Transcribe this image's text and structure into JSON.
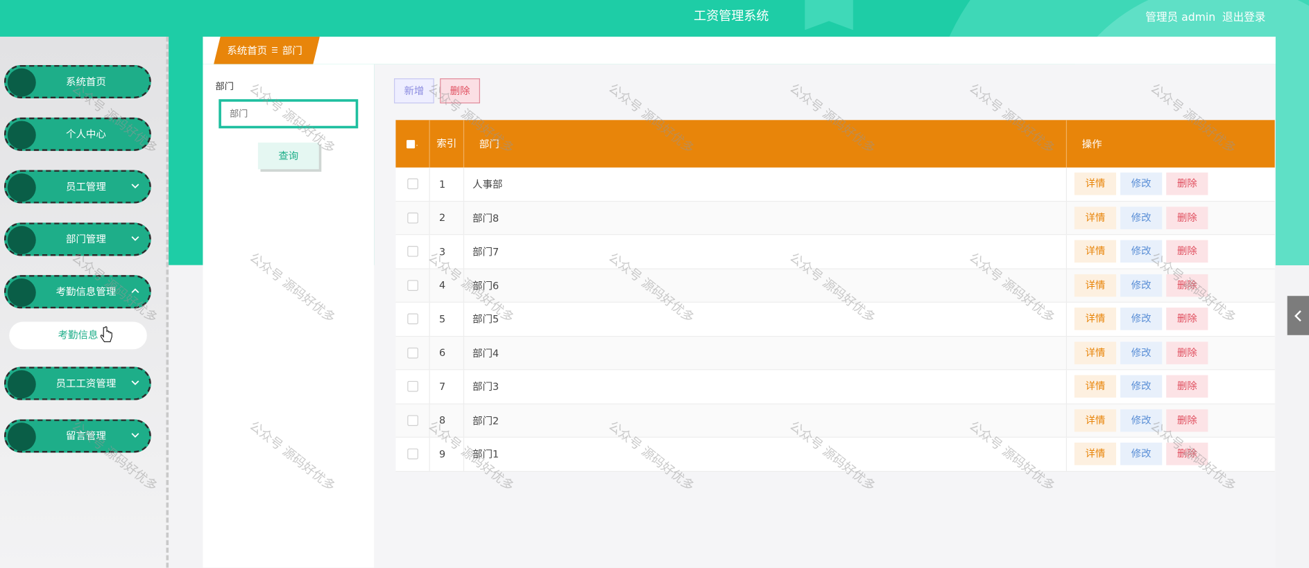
{
  "header": {
    "app_title": "工资管理系统",
    "user_label": "管理员 admin",
    "logout_label": "退出登录"
  },
  "sidebar": {
    "items": [
      {
        "label": "系统首页",
        "has_arrow": false
      },
      {
        "label": "个人中心",
        "has_arrow": false
      },
      {
        "label": "员工管理",
        "has_arrow": true,
        "arrow": "chevron-down-icon"
      },
      {
        "label": "部门管理",
        "has_arrow": true,
        "arrow": "chevron-down-icon"
      },
      {
        "label": "考勤信息管理",
        "has_arrow": true,
        "arrow": "chevron-up-icon"
      },
      {
        "label": "员工工资管理",
        "has_arrow": true,
        "arrow": "chevron-down-icon"
      },
      {
        "label": "留言管理",
        "has_arrow": true,
        "arrow": "chevron-down-icon"
      }
    ],
    "submenu": {
      "label": "考勤信息"
    }
  },
  "breadcrumb": {
    "home": "系统首页",
    "separator": "☰",
    "current": "部门"
  },
  "search": {
    "label": "部门",
    "placeholder": "部门",
    "query_button": "查询"
  },
  "toolbar": {
    "add_label": "新增",
    "delete_label": "删除"
  },
  "table": {
    "headers": {
      "index": "索引",
      "dept": "部门",
      "ops": "操作"
    },
    "rows": [
      {
        "index": "1",
        "dept": "人事部"
      },
      {
        "index": "2",
        "dept": "部门8"
      },
      {
        "index": "3",
        "dept": "部门7"
      },
      {
        "index": "4",
        "dept": "部门6"
      },
      {
        "index": "5",
        "dept": "部门5"
      },
      {
        "index": "6",
        "dept": "部门4"
      },
      {
        "index": "7",
        "dept": "部门3"
      },
      {
        "index": "8",
        "dept": "部门2"
      },
      {
        "index": "9",
        "dept": "部门1"
      }
    ],
    "ops": {
      "detail": "详情",
      "edit": "修改",
      "remove": "删除"
    }
  },
  "watermark": "公众号 源码好优多",
  "colors": {
    "primary": "#1ecda6",
    "sidebar_item": "#1eae89",
    "accent": "#e8850a",
    "danger": "#e05060",
    "info": "#5b8fd6"
  }
}
